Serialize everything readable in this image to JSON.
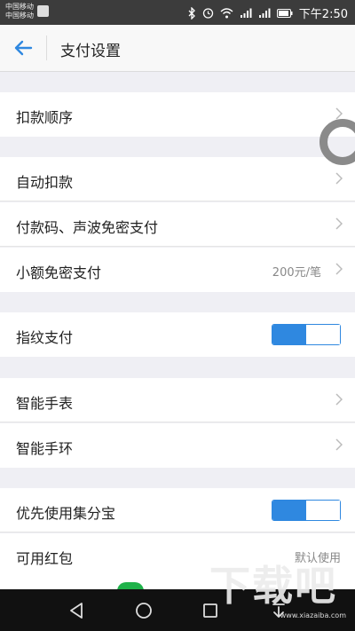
{
  "status_bar": {
    "carrier_lines": [
      "中国移动",
      "中国移动"
    ],
    "time": "下午2:50",
    "icons": [
      "bluetooth-icon",
      "alarm-icon",
      "wifi-icon",
      "signal-icon",
      "signal-icon",
      "battery-icon"
    ]
  },
  "header": {
    "title": "支付设置",
    "back_icon": "arrow-left-icon",
    "accent": "#2f88e0"
  },
  "rows": {
    "deduction_order": {
      "label": "扣款顺序"
    },
    "auto_deduct": {
      "label": "自动扣款"
    },
    "paycode_soundwave": {
      "label": "付款码、声波免密支付"
    },
    "small_amount": {
      "label": "小额免密支付",
      "value": "200元/笔"
    },
    "fingerprint": {
      "label": "指纹支付",
      "toggle_on": true
    },
    "smart_watch": {
      "label": "智能手表"
    },
    "smart_band": {
      "label": "智能手环"
    },
    "jifenbao": {
      "label": "优先使用集分宝",
      "toggle_on": true
    },
    "red_packet": {
      "label": "可用红包",
      "value": "默认使用"
    }
  },
  "nav_bar": {
    "icons": [
      "back-triangle-icon",
      "home-circle-icon",
      "recents-square-icon",
      "notification-down-icon"
    ]
  },
  "watermark": {
    "text": "下载吧",
    "url": "www.xiazaiba.com"
  }
}
